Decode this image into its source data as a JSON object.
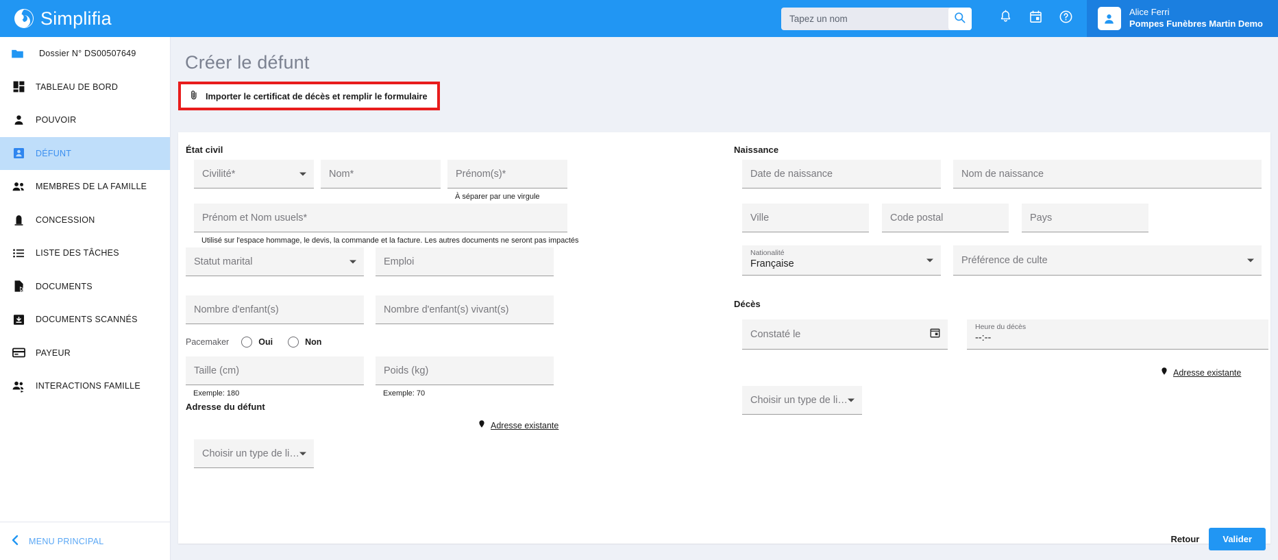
{
  "header": {
    "brand": "Simplifia",
    "logo_icon": "simplifia-logo-icon",
    "search": {
      "placeholder": "Tapez un nom",
      "value": "",
      "icon": "search-icon"
    },
    "icons": [
      {
        "name": "notifications-icon",
        "label": "Notifications"
      },
      {
        "name": "calendar-icon",
        "label": "Agenda"
      },
      {
        "name": "help-icon",
        "label": "Aide"
      }
    ],
    "user": {
      "name": "Alice Ferri",
      "org": "Pompes Funèbres Martin Demo",
      "avatar_icon": "user-avatar-icon"
    }
  },
  "sidebar": {
    "items": [
      {
        "label": "Dossier N° DS00507649",
        "icon": "folder-icon",
        "active": false
      },
      {
        "label": "TABLEAU DE BORD",
        "icon": "dashboard-icon",
        "active": false
      },
      {
        "label": "POUVOIR",
        "icon": "person-icon",
        "active": false
      },
      {
        "label": "DÉFUNT",
        "icon": "badge-person-icon",
        "active": true
      },
      {
        "label": "MEMBRES DE LA FAMILLE",
        "icon": "people-icon",
        "active": false
      },
      {
        "label": "CONCESSION",
        "icon": "tombstone-icon",
        "active": false
      },
      {
        "label": "LISTE DES TÂCHES",
        "icon": "list-icon",
        "active": false
      },
      {
        "label": "DOCUMENTS",
        "icon": "document-icon",
        "active": false
      },
      {
        "label": "DOCUMENTS SCANNÉS",
        "icon": "scanned-document-icon",
        "active": false
      },
      {
        "label": "PAYEUR",
        "icon": "credit-card-icon",
        "active": false
      },
      {
        "label": "INTERACTIONS FAMILLE",
        "icon": "people-arrow-icon",
        "active": false
      }
    ],
    "menu_principal": {
      "label": "MENU PRINCIPAL",
      "icon": "chevron-left-icon"
    }
  },
  "page": {
    "title": "Créer le défunt",
    "import_button": {
      "label": "Importer le certificat de décès et remplir le formulaire",
      "icon": "paperclip-icon"
    },
    "highlight_color": "#e81c1c"
  },
  "etat_civil": {
    "title": "État civil",
    "civilite": {
      "placeholder": "Civilité*",
      "value": ""
    },
    "nom": {
      "placeholder": "Nom*",
      "value": ""
    },
    "prenoms": {
      "placeholder": "Prénom(s)*",
      "value": "",
      "hint": "À séparer par une virgule"
    },
    "prenom_nom_usuels": {
      "placeholder": "Prénom et Nom usuels*",
      "value": "",
      "hint": "Utilisé sur l'espace hommage, le devis, la commande et la facture. Les autres documents ne seront pas impactés"
    },
    "statut_marital": {
      "placeholder": "Statut marital",
      "value": ""
    },
    "emploi": {
      "placeholder": "Emploi",
      "value": ""
    },
    "nombre_enfants": {
      "placeholder": "Nombre d'enfant(s)",
      "value": ""
    },
    "nombre_enfants_vivants": {
      "placeholder": "Nombre d'enfant(s) vivant(s)",
      "value": ""
    },
    "pacemaker": {
      "label": "Pacemaker",
      "options": [
        "Oui",
        "Non"
      ],
      "selected": ""
    },
    "taille": {
      "placeholder": "Taille (cm)",
      "value": "",
      "hint": "Exemple: 180"
    },
    "poids": {
      "placeholder": "Poids (kg)",
      "value": "",
      "hint": "Exemple: 70"
    }
  },
  "adresse_defunt": {
    "title": "Adresse du défunt",
    "existing_link": {
      "label": "Adresse existante",
      "icon": "location-pin-icon"
    },
    "type_lieu": {
      "placeholder": "Choisir un type de li…",
      "value": ""
    }
  },
  "naissance": {
    "title": "Naissance",
    "date_naissance": {
      "placeholder": "Date de naissance",
      "value": ""
    },
    "nom_naissance": {
      "placeholder": "Nom de naissance",
      "value": ""
    },
    "ville": {
      "placeholder": "Ville",
      "value": ""
    },
    "code_postal": {
      "placeholder": "Code postal",
      "value": ""
    },
    "pays": {
      "placeholder": "Pays",
      "value": ""
    },
    "nationalite": {
      "label": "Nationalité",
      "value": "Française"
    },
    "preference_culte": {
      "placeholder": "Préférence de culte",
      "value": ""
    }
  },
  "deces": {
    "title": "Décès",
    "constate_le": {
      "placeholder": "Constaté le",
      "value": "",
      "icon": "calendar-icon"
    },
    "heure_deces": {
      "label": "Heure du décès",
      "value": "--:--"
    },
    "existing_link": {
      "label": "Adresse existante",
      "icon": "location-pin-icon"
    },
    "type_lieu": {
      "placeholder": "Choisir un type de li…",
      "value": ""
    }
  },
  "footer": {
    "retour": "Retour",
    "valider": "Valider",
    "accent_color": "#2196f3"
  }
}
